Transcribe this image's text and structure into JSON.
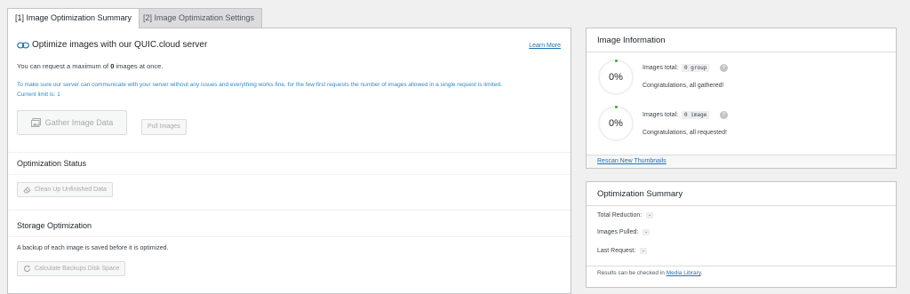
{
  "tabs": [
    {
      "label": "[1] Image Optimization Summary"
    },
    {
      "label": "[2] Image Optimization Settings"
    }
  ],
  "main": {
    "title": "Optimize images with our QUIC.cloud server",
    "learn_more": "Learn More",
    "max_prefix": "You can request a maximum of",
    "max_value": "0",
    "max_suffix": "images at once.",
    "note": "To make sure our server can communicate with your server without any issues and everything works fine, for the few first requests the number of images allowed in a single request is limited.",
    "current_limit": "Current limit is: 1",
    "gather_button": "Gather Image Data",
    "pull_button": "Pull Images",
    "optimization_status_title": "Optimization Status",
    "cleanup_button": "Clean Up Unfinished Data",
    "storage_title": "Storage Optimization",
    "backup_text": "A backup of each image is saved before it is optimized.",
    "calc_button": "Calculate Backups Disk Space"
  },
  "info": {
    "title": "Image Information",
    "stats": [
      {
        "percent": "0%",
        "label": "Images total:",
        "code": "0 group",
        "status": "Congratulations, all gathered!"
      },
      {
        "percent": "0%",
        "label": "Images total:",
        "code": "0 image",
        "status": "Congratulations, all requested!"
      }
    ],
    "help_glyph": "?",
    "rescan": "Rescan New Thumbnails"
  },
  "summary": {
    "title": "Optimization Summary",
    "rows": [
      {
        "label": "Total Reduction:",
        "value": "-"
      },
      {
        "label": "Images Pulled:",
        "value": "-"
      },
      {
        "label": "Last Request:",
        "value": "-"
      }
    ],
    "note_prefix": "Results can be checked in",
    "note_link": "Media Library",
    "note_suffix": "."
  },
  "colors": {
    "link": "#2271b1",
    "note": "#2f89c6",
    "progress": "#4caf50"
  }
}
